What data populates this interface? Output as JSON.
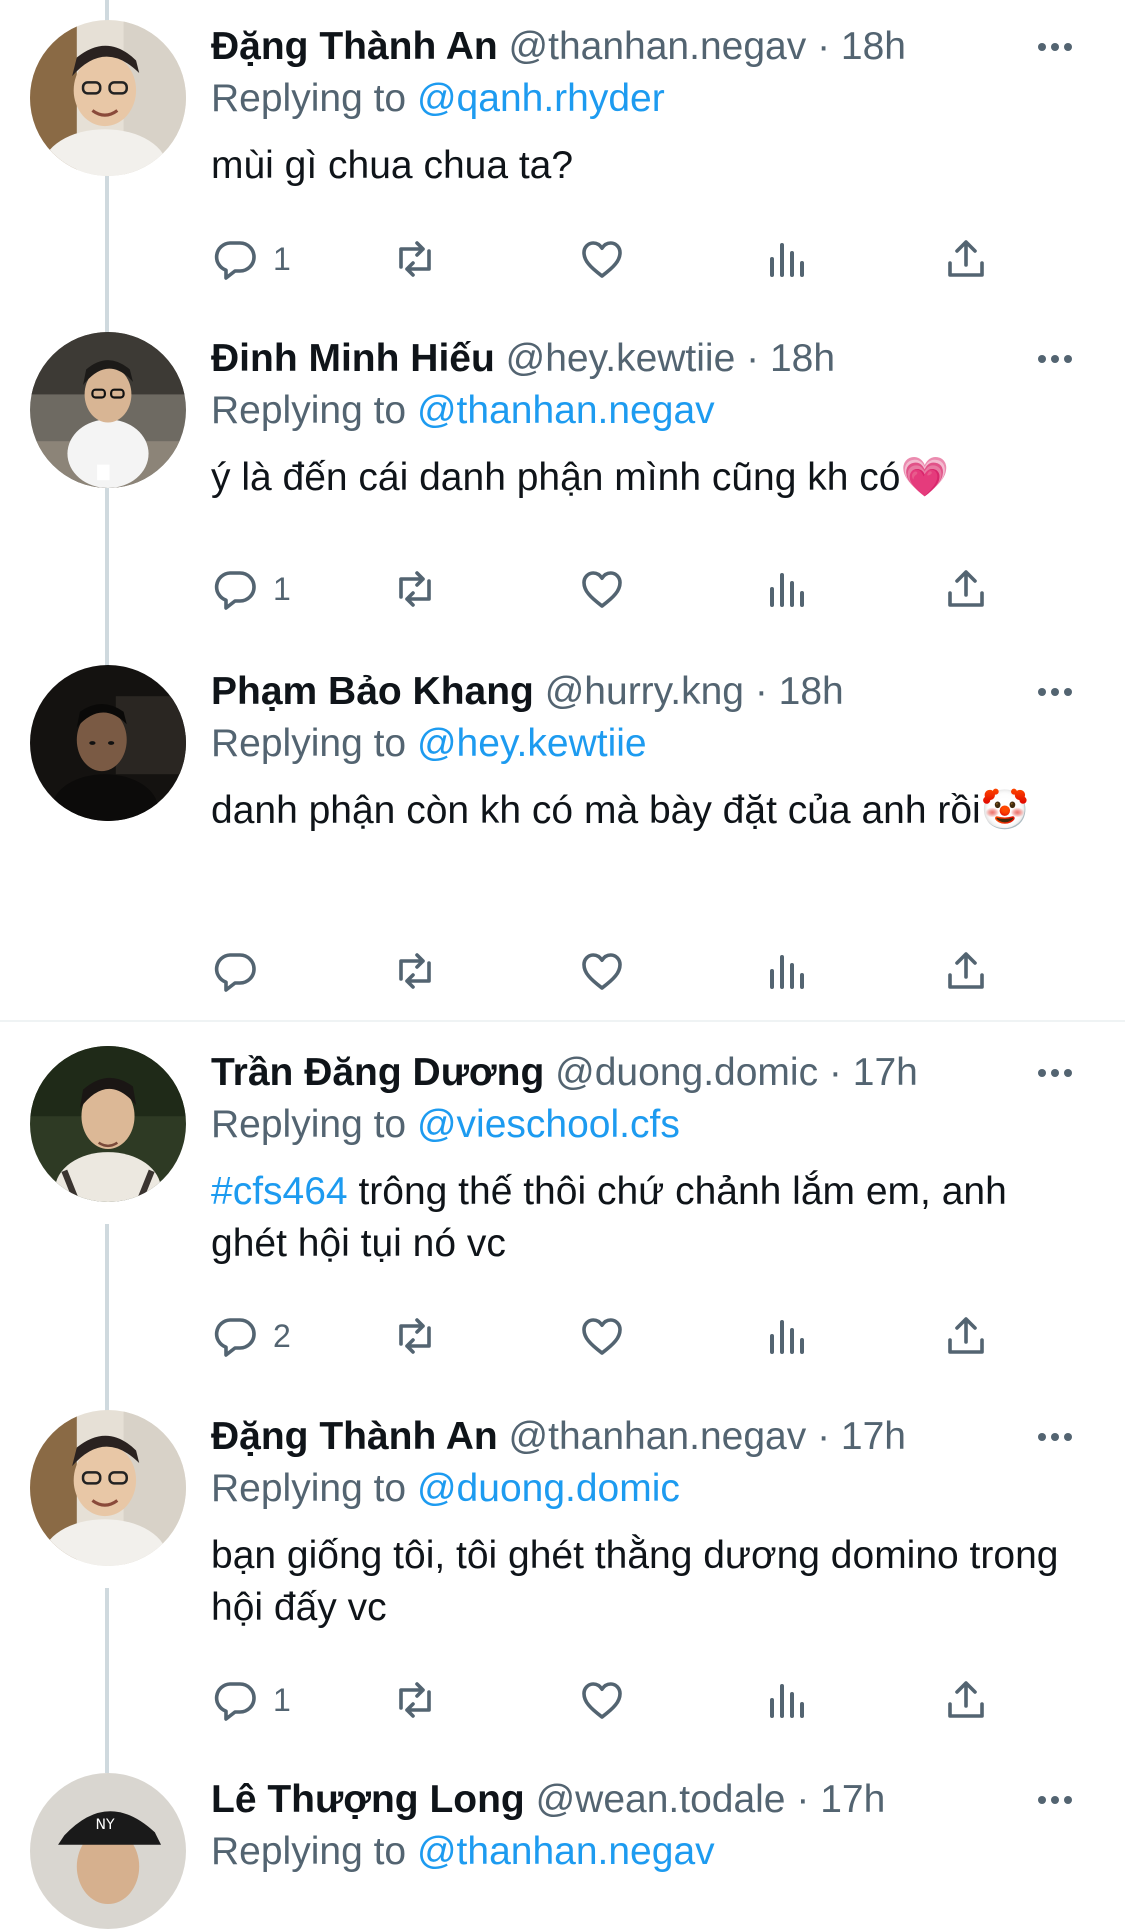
{
  "colors": {
    "accent": "#1d9bf0",
    "muted": "#536471",
    "text": "#0f1419",
    "thread_line": "#cfd9de"
  },
  "icons": {
    "reply": "reply-icon",
    "retweet": "retweet-icon",
    "like": "heart-icon",
    "views": "bar-chart-icon",
    "share": "share-icon",
    "more": "more-dots-icon"
  },
  "tweets": [
    {
      "name": "Đặng Thành An",
      "handle": "@thanhan.negav",
      "time": "18h",
      "replying_label": "Replying to",
      "replying_to": "@qanh.rhyder",
      "text": "mùi gì chua chua ta?",
      "hashtag": "",
      "reply_count": "1"
    },
    {
      "name": "Đinh Minh Hiếu",
      "handle": "@hey.kewtiie",
      "time": "18h",
      "replying_label": "Replying to",
      "replying_to": "@thanhan.negav",
      "text": "ý là đến cái danh phận mình cũng kh có💗",
      "hashtag": "",
      "reply_count": "1"
    },
    {
      "name": "Phạm Bảo Khang",
      "handle": "@hurry.kng",
      "time": "18h",
      "replying_label": "Replying to",
      "replying_to": "@hey.kewtiie",
      "text": "danh phận còn kh có mà bày đặt của anh rồi🤡",
      "hashtag": "",
      "reply_count": ""
    },
    {
      "name": "Trần Đăng Dương",
      "handle": "@duong.domic",
      "time": "17h",
      "replying_label": "Replying to",
      "replying_to": "@vieschool.cfs",
      "text": " trông thế thôi chứ chảnh lắm em, anh ghét hội tụi nó vc",
      "hashtag": "#cfs464",
      "reply_count": "2"
    },
    {
      "name": "Đặng Thành An",
      "handle": "@thanhan.negav",
      "time": "17h",
      "replying_label": "Replying to",
      "replying_to": "@duong.domic",
      "text": "bạn giống tôi, tôi ghét thằng dương domino trong hội đấy vc",
      "hashtag": "",
      "reply_count": "1"
    },
    {
      "name": "Lê Thượng Long",
      "handle": "@wean.todale",
      "time": "17h",
      "replying_label": "Replying to",
      "replying_to": "@thanhan.negav",
      "text": "",
      "hashtag": "",
      "reply_count": ""
    }
  ]
}
